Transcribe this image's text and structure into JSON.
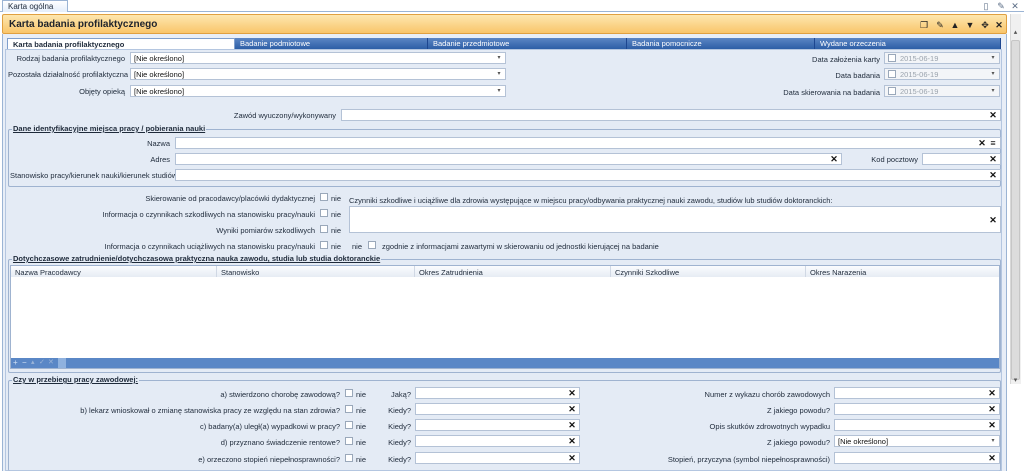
{
  "outer_tab": "Karta ogólna",
  "window_title": "Karta badania profilaktycznego",
  "tabs": [
    "Karta badania profilaktycznego",
    "Badanie podmiotowe",
    "Badanie przedmiotowe",
    "Badania pomocnicze",
    "Wydane orzeczenia"
  ],
  "top": {
    "rodzaj_label": "Rodzaj badania profilaktycznego",
    "rodzaj_value": "[Nie określono]",
    "pozostala_label": "Pozostała działalność profilaktyczna",
    "pozostala_value": "[Nie określono]",
    "objety_label": "Objęty opieką",
    "objety_value": "[Nie określono]",
    "data_zal_label": "Data założenia karty",
    "data_zal_value": "2015-06-19",
    "data_bad_label": "Data badania",
    "data_bad_value": "2015-06-19",
    "data_skier_label": "Data skierowania na badania",
    "data_skier_value": "2015-06-19",
    "zawod_label": "Zawód wyuczony/wykonywany"
  },
  "workplace": {
    "legend": "Dane identyfikacyjne miejsca pracy / pobierania nauki",
    "nazwa_label": "Nazwa",
    "adres_label": "Adres",
    "kod_label": "Kod pocztowy",
    "stanowisko_label": "Stanowisko pracy/kierunek nauki/kierunek studiów"
  },
  "factors": {
    "skierowanie_label": "Skierowanie od pracodawcy/placówki dydaktycznej",
    "informacja_szk_label": "Informacja o czynnikach szkodliwych na stanowisku pracy/nauki",
    "wyniki_label": "Wyniki pomiarów szkodliwych",
    "informacja_uci_label": "Informacja o czynnikach uciążliwych na stanowisku pracy/nauki",
    "nie": "nie",
    "czynniki_label": "Czynniki szkodliwe i uciążliwe dla zdrowia występujące w miejscu pracy/odbywania praktycznej nauki zawodu, studiów lub studiów doktoranckich:",
    "zgodnie_label": "zgodnie z informacjami zawartymi w skierowaniu od jednostki kierującej na badanie"
  },
  "employment": {
    "legend": "Dotychczasowe zatrudnienie/dotychczasowa praktyczna nauka zawodu, studia lub studia doktoranckie",
    "columns": [
      "Nazwa Pracodawcy",
      "Stanowisko",
      "Okres Zatrudnienia",
      "Czynniki Szkodliwe",
      "Okres Narazenia"
    ]
  },
  "history": {
    "legend": "Czy w przebiegu pracy zawodowej:",
    "rows": [
      {
        "question": "a) stwierdzono chorobę zawodową?",
        "nie": "nie",
        "mid": "Jaką?",
        "right_label": "Numer z wykazu chorób zawodowych",
        "right_value": "",
        "right_type": "text"
      },
      {
        "question": "b) lekarz wnioskował o zmianę stanowiska pracy ze względu na stan zdrowia?",
        "nie": "nie",
        "mid": "Kiedy?",
        "right_label": "Z jakiego powodu?",
        "right_value": "",
        "right_type": "text"
      },
      {
        "question": "c) badany(a) uległ(a) wypadkowi w pracy?",
        "nie": "nie",
        "mid": "Kiedy?",
        "right_label": "Opis skutków zdrowotnych wypadku",
        "right_value": "",
        "right_type": "text"
      },
      {
        "question": "d) przyznano świadczenie rentowe?",
        "nie": "nie",
        "mid": "Kiedy?",
        "right_label": "Z jakiego powodu?",
        "right_value": "[Nie określono]",
        "right_type": "select"
      },
      {
        "question": "e) orzeczono stopień niepełnosprawności?",
        "nie": "nie",
        "mid": "Kiedy?",
        "right_label": "Stopień, przyczyna (symbol niepełnosprawności)",
        "right_value": "",
        "right_type": "text"
      }
    ]
  }
}
